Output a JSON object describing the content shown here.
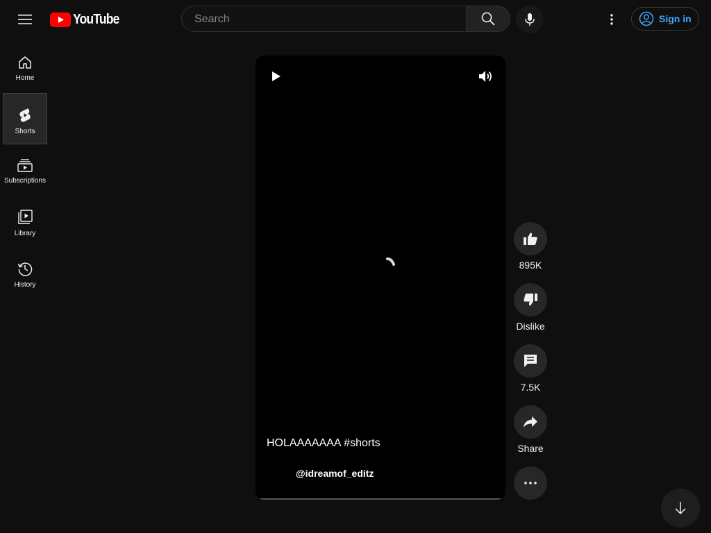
{
  "header": {
    "logo_text": "YouTube",
    "search_placeholder": "Search",
    "signin_label": "Sign in"
  },
  "sidebar": {
    "items": [
      {
        "label": "Home",
        "icon": "home-icon"
      },
      {
        "label": "Shorts",
        "icon": "shorts-icon",
        "active": true
      },
      {
        "label": "Subscriptions",
        "icon": "subscriptions-icon"
      },
      {
        "label": "Library",
        "icon": "library-icon"
      },
      {
        "label": "History",
        "icon": "history-icon"
      }
    ]
  },
  "video": {
    "title": "HOLAAAAAAA #shorts",
    "channel": "@idreamof_editz"
  },
  "actions": {
    "like_count": "895K",
    "dislike_label": "Dislike",
    "comment_count": "7.5K",
    "share_label": "Share"
  },
  "colors": {
    "background": "#0f0f0f",
    "brand_red": "#ff0000",
    "signin_blue": "#3ea6ff",
    "button_bg": "#272727"
  }
}
